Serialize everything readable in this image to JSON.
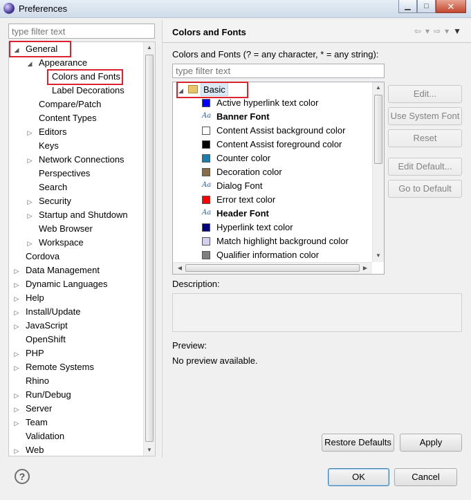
{
  "window": {
    "title": "Preferences",
    "buttons": {
      "minimize": "▁",
      "maximize": "□",
      "close": "✕"
    }
  },
  "left": {
    "filter_placeholder": "type filter text",
    "tree": [
      {
        "label": "General",
        "level": 0,
        "arrow": "◢"
      },
      {
        "label": "Appearance",
        "level": 1,
        "arrow": "◢"
      },
      {
        "label": "Colors and Fonts",
        "level": 2,
        "arrow": ""
      },
      {
        "label": "Label Decorations",
        "level": 2,
        "arrow": ""
      },
      {
        "label": "Compare/Patch",
        "level": 1,
        "arrow": ""
      },
      {
        "label": "Content Types",
        "level": 1,
        "arrow": ""
      },
      {
        "label": "Editors",
        "level": 1,
        "arrow": "▷"
      },
      {
        "label": "Keys",
        "level": 1,
        "arrow": ""
      },
      {
        "label": "Network Connections",
        "level": 1,
        "arrow": "▷"
      },
      {
        "label": "Perspectives",
        "level": 1,
        "arrow": ""
      },
      {
        "label": "Search",
        "level": 1,
        "arrow": ""
      },
      {
        "label": "Security",
        "level": 1,
        "arrow": "▷"
      },
      {
        "label": "Startup and Shutdown",
        "level": 1,
        "arrow": "▷"
      },
      {
        "label": "Web Browser",
        "level": 1,
        "arrow": ""
      },
      {
        "label": "Workspace",
        "level": 1,
        "arrow": "▷"
      },
      {
        "label": "Cordova",
        "level": 0,
        "arrow": ""
      },
      {
        "label": "Data Management",
        "level": 0,
        "arrow": "▷"
      },
      {
        "label": "Dynamic Languages",
        "level": 0,
        "arrow": "▷"
      },
      {
        "label": "Help",
        "level": 0,
        "arrow": "▷"
      },
      {
        "label": "Install/Update",
        "level": 0,
        "arrow": "▷"
      },
      {
        "label": "JavaScript",
        "level": 0,
        "arrow": "▷"
      },
      {
        "label": "OpenShift",
        "level": 0,
        "arrow": ""
      },
      {
        "label": "PHP",
        "level": 0,
        "arrow": "▷"
      },
      {
        "label": "Remote Systems",
        "level": 0,
        "arrow": "▷"
      },
      {
        "label": "Rhino",
        "level": 0,
        "arrow": ""
      },
      {
        "label": "Run/Debug",
        "level": 0,
        "arrow": "▷"
      },
      {
        "label": "Server",
        "level": 0,
        "arrow": "▷"
      },
      {
        "label": "Team",
        "level": 0,
        "arrow": "▷"
      },
      {
        "label": "Validation",
        "level": 0,
        "arrow": ""
      },
      {
        "label": "Web",
        "level": 0,
        "arrow": "▷"
      }
    ]
  },
  "page": {
    "title": "Colors and Fonts",
    "filter_label": "Colors and Fonts (? = any character, * = any string):",
    "filter_placeholder": "type filter text",
    "category": "Basic",
    "items": [
      {
        "label": "Active hyperlink text color",
        "kind": "color",
        "color": "#0000ff",
        "bold": false
      },
      {
        "label": "Banner Font",
        "kind": "font",
        "color": "",
        "bold": true
      },
      {
        "label": "Content Assist background color",
        "kind": "color",
        "color": "#ffffff",
        "bold": false
      },
      {
        "label": "Content Assist foreground color",
        "kind": "color",
        "color": "#000000",
        "bold": false
      },
      {
        "label": "Counter color",
        "kind": "color",
        "color": "#1a7fb0",
        "bold": false
      },
      {
        "label": "Decoration color",
        "kind": "color",
        "color": "#8a6e47",
        "bold": false
      },
      {
        "label": "Dialog Font",
        "kind": "font",
        "color": "",
        "bold": false
      },
      {
        "label": "Error text color",
        "kind": "color",
        "color": "#ff0000",
        "bold": false
      },
      {
        "label": "Header Font",
        "kind": "font",
        "color": "",
        "bold": true
      },
      {
        "label": "Hyperlink text color",
        "kind": "color",
        "color": "#000080",
        "bold": false
      },
      {
        "label": "Match highlight background color",
        "kind": "color",
        "color": "#d4d0f0",
        "bold": false
      },
      {
        "label": "Qualifier information color",
        "kind": "color",
        "color": "#808080",
        "bold": false
      }
    ],
    "side_buttons": [
      "Edit...",
      "Use System Font",
      "Reset",
      "Edit Default...",
      "Go to Default"
    ],
    "description_label": "Description:",
    "preview_label": "Preview:",
    "preview_text": "No preview available.",
    "restore_defaults": "Restore Defaults",
    "apply": "Apply"
  },
  "footer": {
    "help": "?",
    "ok": "OK",
    "cancel": "Cancel"
  },
  "font_icon": "Aa"
}
